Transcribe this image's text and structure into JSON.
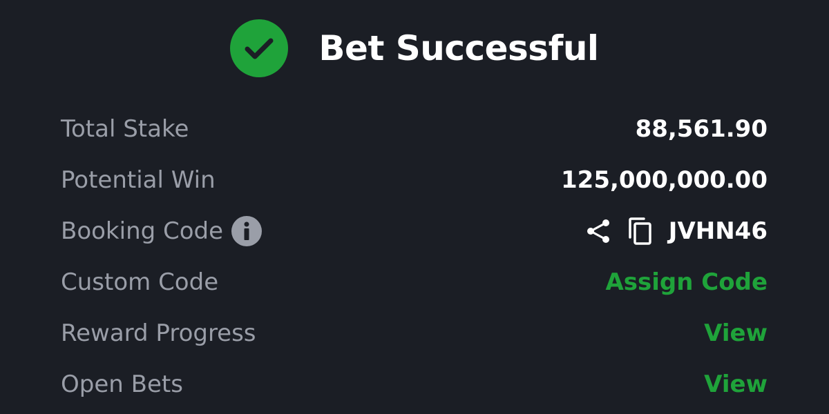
{
  "header": {
    "title": "Bet Successful",
    "status_icon": "check-circle-icon",
    "accent_color": "#1fa33a"
  },
  "rows": {
    "total_stake": {
      "label": "Total Stake",
      "value": "88,561.90"
    },
    "potential_win": {
      "label": "Potential Win",
      "value": "125,000,000.00"
    },
    "booking_code": {
      "label": "Booking Code",
      "value": "JVHN46",
      "info_icon": "info-icon",
      "share_icon": "share-icon",
      "copy_icon": "copy-icon"
    },
    "custom_code": {
      "label": "Custom Code",
      "action": "Assign Code"
    },
    "reward_progress": {
      "label": "Reward Progress",
      "action": "View"
    },
    "open_bets": {
      "label": "Open Bets",
      "action": "View"
    }
  }
}
